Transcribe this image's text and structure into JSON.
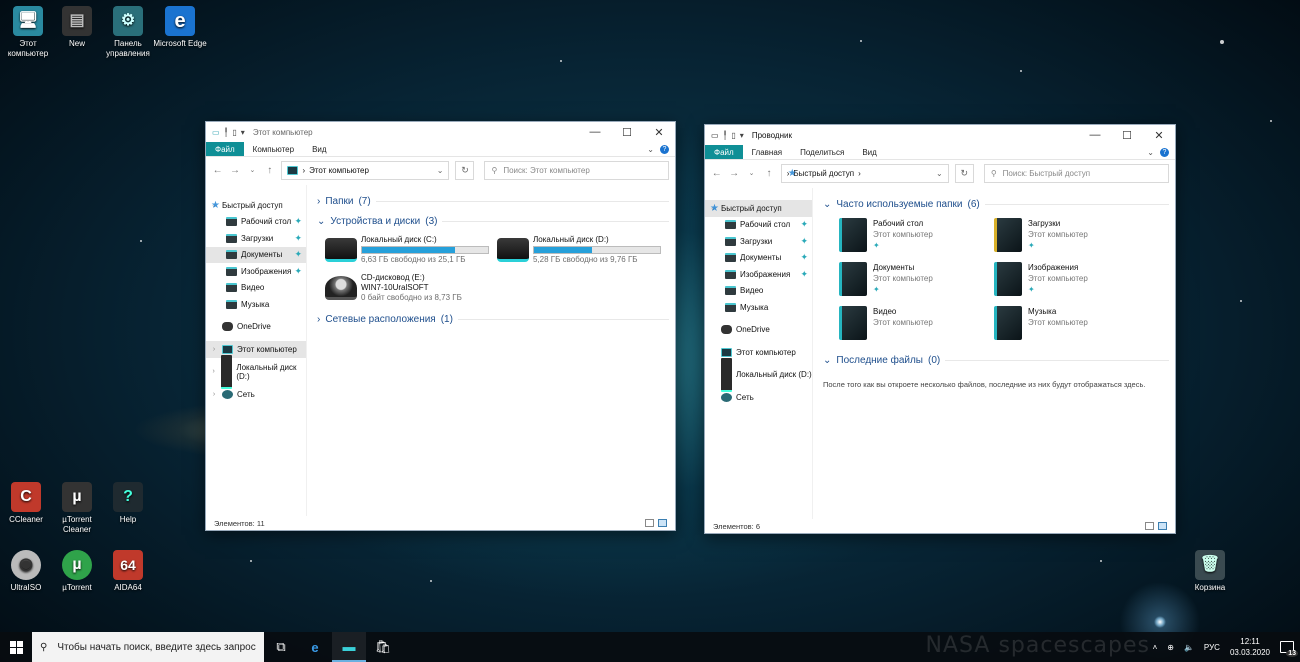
{
  "desktop": {
    "icons": [
      {
        "label": "Этот компьютер",
        "glyph": "🖥"
      },
      {
        "label": "New",
        "glyph": "▤"
      },
      {
        "label": "Панель управления",
        "glyph": "⚙"
      },
      {
        "label": "Microsoft Edge",
        "glyph": "e"
      },
      {
        "label": "CCleaner",
        "glyph": "C"
      },
      {
        "label": "µTorrent Cleaner",
        "glyph": "µ"
      },
      {
        "label": "Help",
        "glyph": "?"
      },
      {
        "label": "UltraISO",
        "glyph": "◉"
      },
      {
        "label": "µTorrent",
        "glyph": "µ"
      },
      {
        "label": "AIDA64",
        "glyph": "64"
      },
      {
        "label": "Корзина",
        "glyph": "🗑"
      }
    ]
  },
  "win1": {
    "title": "Этот компьютер",
    "ribbon_tabs": [
      "Файл",
      "Компьютер",
      "Вид"
    ],
    "address": "Этот компьютер",
    "search_placeholder": "Поиск: Этот компьютер",
    "nav": {
      "quick_access": "Быстрый доступ",
      "items": [
        "Рабочий стол",
        "Загрузки",
        "Документы",
        "Изображения",
        "Видео",
        "Музыка"
      ],
      "onedrive": "OneDrive",
      "this_pc": "Этот компьютер",
      "local_disk": "Локальный диск (D:)",
      "network": "Сеть"
    },
    "groups": {
      "folders": {
        "label": "Папки",
        "count": "(7)"
      },
      "devices": {
        "label": "Устройства и диски",
        "count": "(3)"
      },
      "network": {
        "label": "Сетевые расположения",
        "count": "(1)"
      }
    },
    "drives": [
      {
        "name": "Локальный диск (C:)",
        "free": "6,63 ГБ свободно из 25,1 ГБ",
        "used_fraction": 0.74
      },
      {
        "name": "Локальный диск (D:)",
        "free": "5,28 ГБ свободно из 9,76 ГБ",
        "used_fraction": 0.46
      }
    ],
    "cd": {
      "name": "CD-дисковод (E:)",
      "label": "WIN7-10UralSOFT",
      "free": "0 байт свободно из 8,73 ГБ"
    },
    "status": "Элементов: 11"
  },
  "win2": {
    "title": "Проводник",
    "ribbon_tabs": [
      "Файл",
      "Главная",
      "Поделиться",
      "Вид"
    ],
    "address": "Быстрый доступ",
    "search_placeholder": "Поиск: Быстрый доступ",
    "nav": {
      "quick_access": "Быстрый доступ",
      "items": [
        "Рабочий стол",
        "Загрузки",
        "Документы",
        "Изображения",
        "Видео",
        "Музыка"
      ],
      "onedrive": "OneDrive",
      "this_pc": "Этот компьютер",
      "local_disk": "Локальный диск (D:)",
      "network": "Сеть"
    },
    "groups": {
      "frequent": {
        "label": "Часто используемые папки",
        "count": "(6)"
      },
      "recent": {
        "label": "Последние файлы",
        "count": "(0)"
      }
    },
    "folders": [
      {
        "name": "Рабочий стол",
        "location": "Этот компьютер"
      },
      {
        "name": "Загрузки",
        "location": "Этот компьютер"
      },
      {
        "name": "Документы",
        "location": "Этот компьютер"
      },
      {
        "name": "Изображения",
        "location": "Этот компьютер"
      },
      {
        "name": "Видео",
        "location": "Этот компьютер"
      },
      {
        "name": "Музыка",
        "location": "Этот компьютер"
      }
    ],
    "recent_empty": "После того как вы откроете несколько файлов, последние из них будут отображаться здесь.",
    "status": "Элементов: 6"
  },
  "taskbar": {
    "search_placeholder": "Чтобы начать поиск, введите здесь запрос",
    "watermark": "NASA spacescapes",
    "lang": "РУС",
    "time": "12:11",
    "date": "03.03.2020",
    "notifications": "13"
  }
}
